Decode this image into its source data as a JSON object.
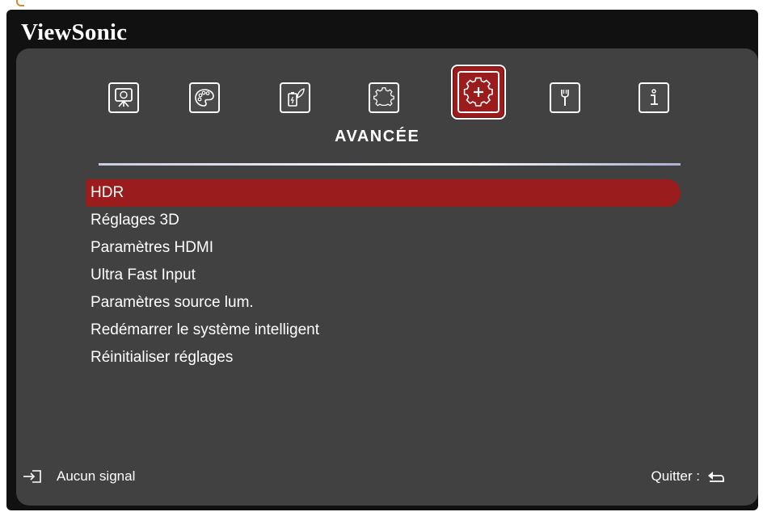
{
  "brand": "ViewSonic",
  "section_title": "AVANCÉE",
  "tabs": [
    {
      "icon": "display-icon"
    },
    {
      "icon": "palette-icon"
    },
    {
      "icon": "power-eco-icon"
    },
    {
      "icon": "settings-gear-icon"
    },
    {
      "icon": "advanced-gear-icon",
      "active": true
    },
    {
      "icon": "wrench-icon"
    },
    {
      "icon": "info-icon"
    }
  ],
  "menu": {
    "items": [
      {
        "label": "HDR"
      },
      {
        "label": "Réglages 3D"
      },
      {
        "label": "Paramètres HDMI"
      },
      {
        "label": "Ultra Fast Input"
      },
      {
        "label": "Paramètres source lum."
      },
      {
        "label": "Redémarrer le système intelligent"
      },
      {
        "label": "Réinitialiser réglages"
      }
    ]
  },
  "footer": {
    "signal": "Aucun signal",
    "quit": "Quitter :"
  },
  "colors": {
    "accent": "#9b1c1c",
    "panel": "#414141",
    "frame": "#111111"
  }
}
